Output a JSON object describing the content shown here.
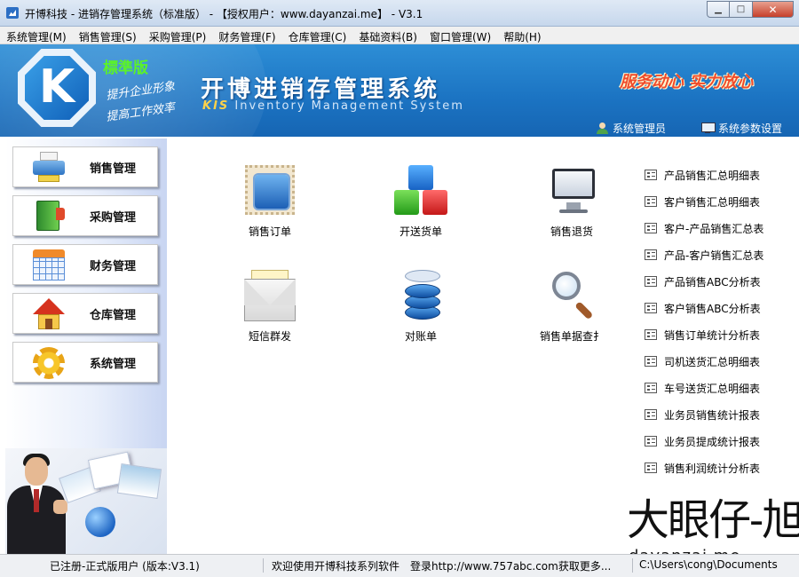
{
  "window": {
    "title": "开博科技 - 进销存管理系统（标准版） - 【授权用户：www.dayanzai.me】 - V3.1",
    "min_glyph": "▁",
    "max_glyph": "□",
    "close_glyph": "✕"
  },
  "menu": [
    "系统管理(M)",
    "销售管理(S)",
    "采购管理(P)",
    "财务管理(F)",
    "仓库管理(C)",
    "基础资料(B)",
    "窗口管理(W)",
    "帮助(H)"
  ],
  "header": {
    "logo_letter": "K",
    "edition": "標準版",
    "slogan_line1": "提升企业形象",
    "slogan_line2": "提高工作效率",
    "system_title": "开博进销存管理系统",
    "subtitle_brand": "KIS",
    "subtitle_rest": " Inventory Management System",
    "motto": "服务动心 实力放心",
    "user_label": "系统管理员",
    "settings_label": "系统参数设置"
  },
  "sidebar": [
    {
      "label": "销售管理",
      "icon": "printer-icon"
    },
    {
      "label": "采购管理",
      "icon": "book-icon"
    },
    {
      "label": "财务管理",
      "icon": "calendar-icon"
    },
    {
      "label": "仓库管理",
      "icon": "house-icon"
    },
    {
      "label": "系统管理",
      "icon": "gear-icon"
    }
  ],
  "functions": [
    {
      "label": "销售订单",
      "icon": "stamp-icon"
    },
    {
      "label": "开送货单",
      "icon": "blocks-icon"
    },
    {
      "label": "销售退货",
      "icon": "monitor-icon"
    },
    {
      "label": "短信群发",
      "icon": "envelope-icon"
    },
    {
      "label": "对账单",
      "icon": "database-icon"
    },
    {
      "label": "销售单据查扌",
      "icon": "magnifier-icon"
    }
  ],
  "reports": [
    "产品销售汇总明细表",
    "客户销售汇总明细表",
    "客户-产品销售汇总表",
    "产品-客户销售汇总表",
    "产品销售ABC分析表",
    "客户销售ABC分析表",
    "销售订单统计分析表",
    "司机送货汇总明细表",
    "车号送货汇总明细表",
    "业务员销售统计报表",
    "业务员提成统计报表",
    "销售利润统计分析表"
  ],
  "watermark": {
    "chinese": "大眼仔-旭",
    "domain": "dayanzai.me"
  },
  "status": {
    "registration": "已注册-正式版用户 (版本:V3.1)",
    "welcome": "欢迎使用开博科技系列软件",
    "login_hint": "登录http://www.757abc.com获取更多...",
    "path": "C:\\Users\\cong\\Documents"
  }
}
